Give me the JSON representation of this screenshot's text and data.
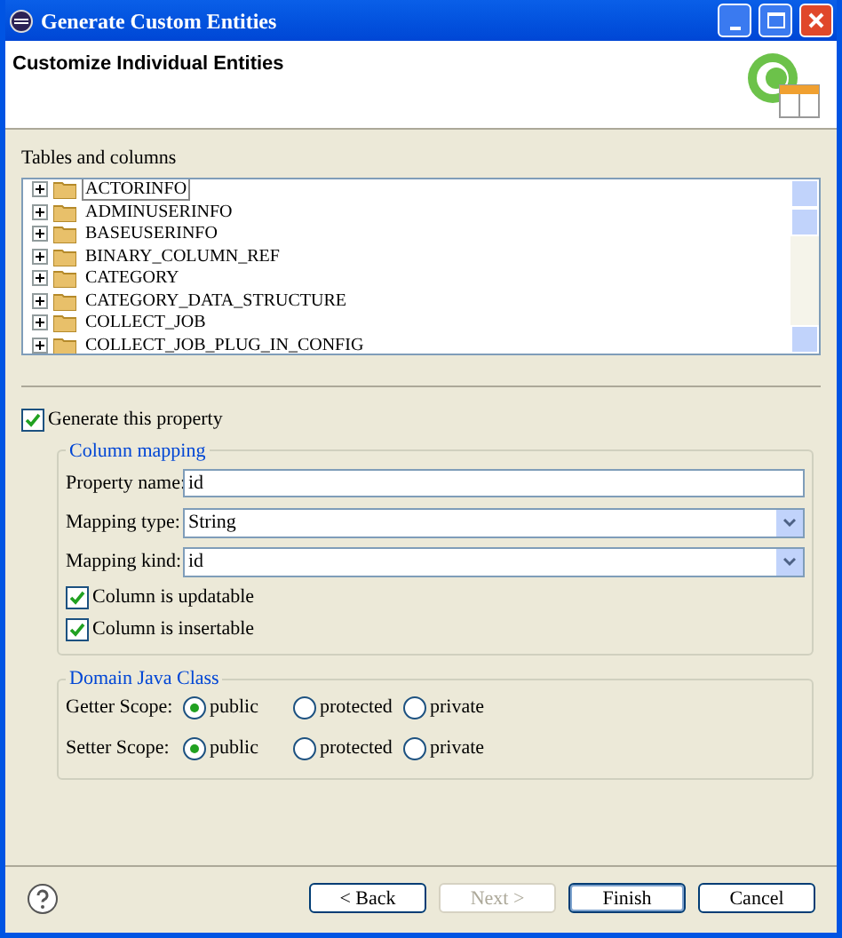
{
  "window": {
    "title": "Generate Custom Entities"
  },
  "header": {
    "title": "Customize Individual Entities"
  },
  "tree": {
    "label": "Tables and columns",
    "items": [
      {
        "label": "ACTORINFO",
        "selected": true
      },
      {
        "label": "ADMINUSERINFO",
        "selected": false
      },
      {
        "label": "BASEUSERINFO",
        "selected": false
      },
      {
        "label": "BINARY_COLUMN_REF",
        "selected": false
      },
      {
        "label": "CATEGORY",
        "selected": false
      },
      {
        "label": "CATEGORY_DATA_STRUCTURE",
        "selected": false
      },
      {
        "label": "COLLECT_JOB",
        "selected": false
      },
      {
        "label": "COLLECT_JOB_PLUG_IN_CONFIG",
        "selected": false
      }
    ]
  },
  "generate_property": {
    "label": "Generate this property",
    "checked": true
  },
  "column_mapping": {
    "title": "Column mapping",
    "fields": [
      {
        "kind": "text",
        "label": "Property name:",
        "value": "id"
      },
      {
        "kind": "combo",
        "label": "Mapping type:",
        "value": "String"
      },
      {
        "kind": "combo",
        "label": "Mapping kind:",
        "value": "id"
      }
    ],
    "checks": [
      {
        "label": "Column is updatable",
        "checked": true
      },
      {
        "label": "Column is insertable",
        "checked": true
      }
    ]
  },
  "domain_java_class": {
    "title": "Domain Java Class",
    "rows": [
      {
        "label": "Getter Scope:",
        "options": [
          {
            "label": "public",
            "selected": true
          },
          {
            "label": "protected",
            "selected": false
          },
          {
            "label": "private",
            "selected": false
          }
        ]
      },
      {
        "label": "Setter Scope:",
        "options": [
          {
            "label": "public",
            "selected": true
          },
          {
            "label": "protected",
            "selected": false
          },
          {
            "label": "private",
            "selected": false
          }
        ]
      }
    ]
  },
  "buttons": [
    {
      "label": "< Back",
      "disabled": false,
      "default": false
    },
    {
      "label": "Next >",
      "disabled": true,
      "default": false
    },
    {
      "label": "Finish",
      "disabled": false,
      "default": true
    },
    {
      "label": "Cancel",
      "disabled": false,
      "default": false
    }
  ]
}
